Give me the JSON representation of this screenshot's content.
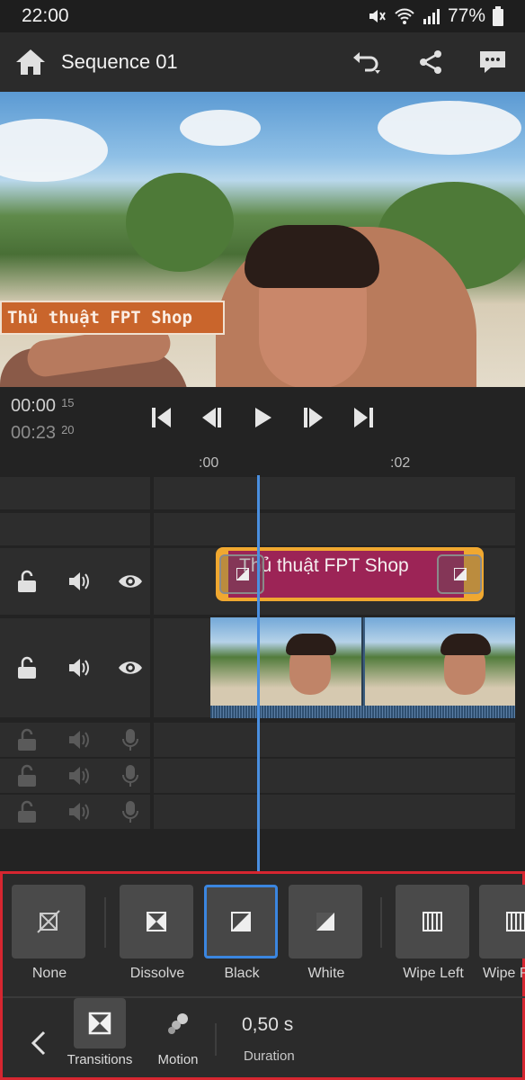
{
  "status_bar": {
    "time": "22:00",
    "battery": "77%"
  },
  "app_bar": {
    "title": "Sequence 01"
  },
  "preview": {
    "overlay_text": "Thủ thuật FPT Shop"
  },
  "transport": {
    "current_time": "00:00",
    "current_frames": "15",
    "total_time": "00:23",
    "total_frames": "20"
  },
  "ruler": {
    "ticks": [
      ":00",
      ":02"
    ]
  },
  "timeline": {
    "title_clip_text": "Thủ thuật FPT Shop"
  },
  "transitions_panel": {
    "items": [
      {
        "label": "None",
        "icon": "no-transition-icon"
      },
      {
        "label": "Dissolve",
        "icon": "dissolve-icon"
      },
      {
        "label": "Black",
        "icon": "dip-black-icon",
        "selected": true
      },
      {
        "label": "White",
        "icon": "dip-white-icon"
      },
      {
        "label": "Wipe Left",
        "icon": "wipe-left-icon"
      },
      {
        "label": "Wipe Right",
        "icon": "wipe-right-icon"
      }
    ],
    "tabs": {
      "transitions": "Transitions",
      "motion": "Motion"
    },
    "duration_value": "0,50 s",
    "duration_label": "Duration"
  },
  "colors": {
    "accent": "#3b86e0",
    "title_clip": "#9c2456",
    "clip_border": "#f0a830",
    "panel_highlight": "#d62630"
  }
}
